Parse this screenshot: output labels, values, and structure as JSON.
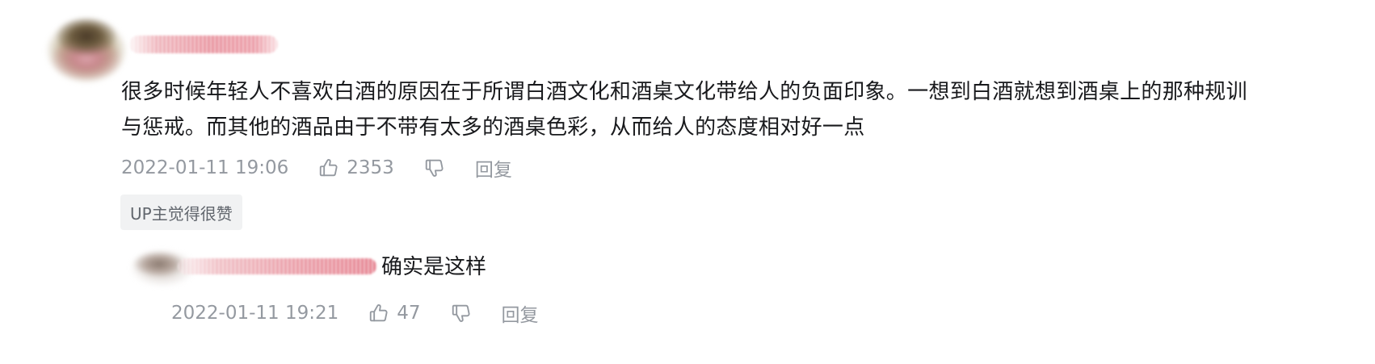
{
  "comment": {
    "text": "很多时候年轻人不喜欢白酒的原因在于所谓白酒文化和酒桌文化带给人的负面印象。一想到白酒就想到酒桌上的那种规训与惩戒。而其他的酒品由于不带有太多的酒桌色彩，从而给人的态度相对好一点",
    "time": "2022-01-11 19:06",
    "likes": "2353",
    "reply_label": "回复",
    "up_tag": "UP主觉得很赞"
  },
  "sub_reply": {
    "text": "确实是这样",
    "time": "2022-01-11 19:21",
    "likes": "47",
    "reply_label": "回复"
  },
  "icons": {
    "like": "thumbs-up-icon",
    "dislike": "thumbs-down-icon"
  },
  "colors": {
    "text": "#18191c",
    "meta": "#9499a0",
    "tag_bg": "#f1f2f3",
    "tag_text": "#61666d"
  }
}
